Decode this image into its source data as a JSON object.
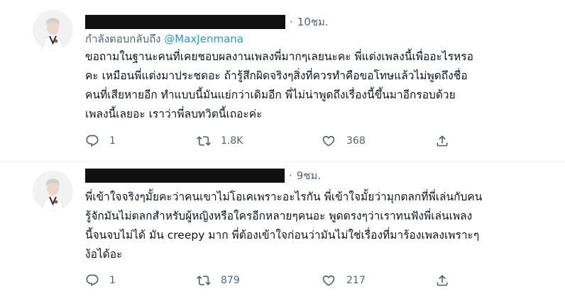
{
  "tweets": [
    {
      "time": "10ชม.",
      "replying_prefix": "กำลังตอบกลับถึง",
      "replying_to": "@MaxJenmana",
      "body_lines": [
        "ขอถามในฐานะคนที่เคยชอบผลงานเพลงพี่มากๆเลยนะคะ  พี่แต่งเพลงนี้เพื่ออะไรหรอ",
        "คะ  เหมือนพี่แต่งมาประชดอะ  ถ้ารู้สึกผิดจริงๆสิ่งที่ควรทำคือขอโทษแล้วไม่พูดถึงชื่อ",
        "คนที่เสียหายอีก  ทำแบบนี้มันแย่กว่าเดิมอีก  พี่ไม่น่าพูดถึงเรื่องนี้ขึ้นมาอีกรอบด้วย",
        "เพลงนี้เลยอะ  เราว่าพี่ลบทวิตนี้เถอะค่ะ"
      ],
      "reply_count": "1",
      "retweet_count": "1.8K",
      "like_count": "368"
    },
    {
      "time": "9ชม.",
      "body_lines": [
        "พี่เข้าใจจริงๆมั้ยคะว่าคนเขาไม่โอเคเพราะอะไรกัน  พี่เข้าใจมั้ยว่ามุกตลกที่พี่เล่นกับคน",
        "รู้จักมันไม่ตลกสำหรับผู้หญิงหรือใครอีกหลายๆคนอะ  พูดตรงๆว่าเราทนฟังพี่เล่นเพลง",
        "นี้จนจบไม่ได้  มัน  creepy  มาก  พี่ต้องเข้าใจก่อนว่ามันไม่ใช่เรื่องที่มาร้องเพลงเพราะๆ",
        "ง้อได้อะ"
      ],
      "reply_count": "1",
      "retweet_count": "879",
      "like_count": "217"
    }
  ],
  "icons": {
    "reply": "reply-icon",
    "retweet": "retweet-icon",
    "like": "heart-icon",
    "avatar": "avatar"
  },
  "colors": {
    "text": "#0f1419",
    "muted": "#536471",
    "mention": "#1d9bf0",
    "redaction": "#111111"
  }
}
